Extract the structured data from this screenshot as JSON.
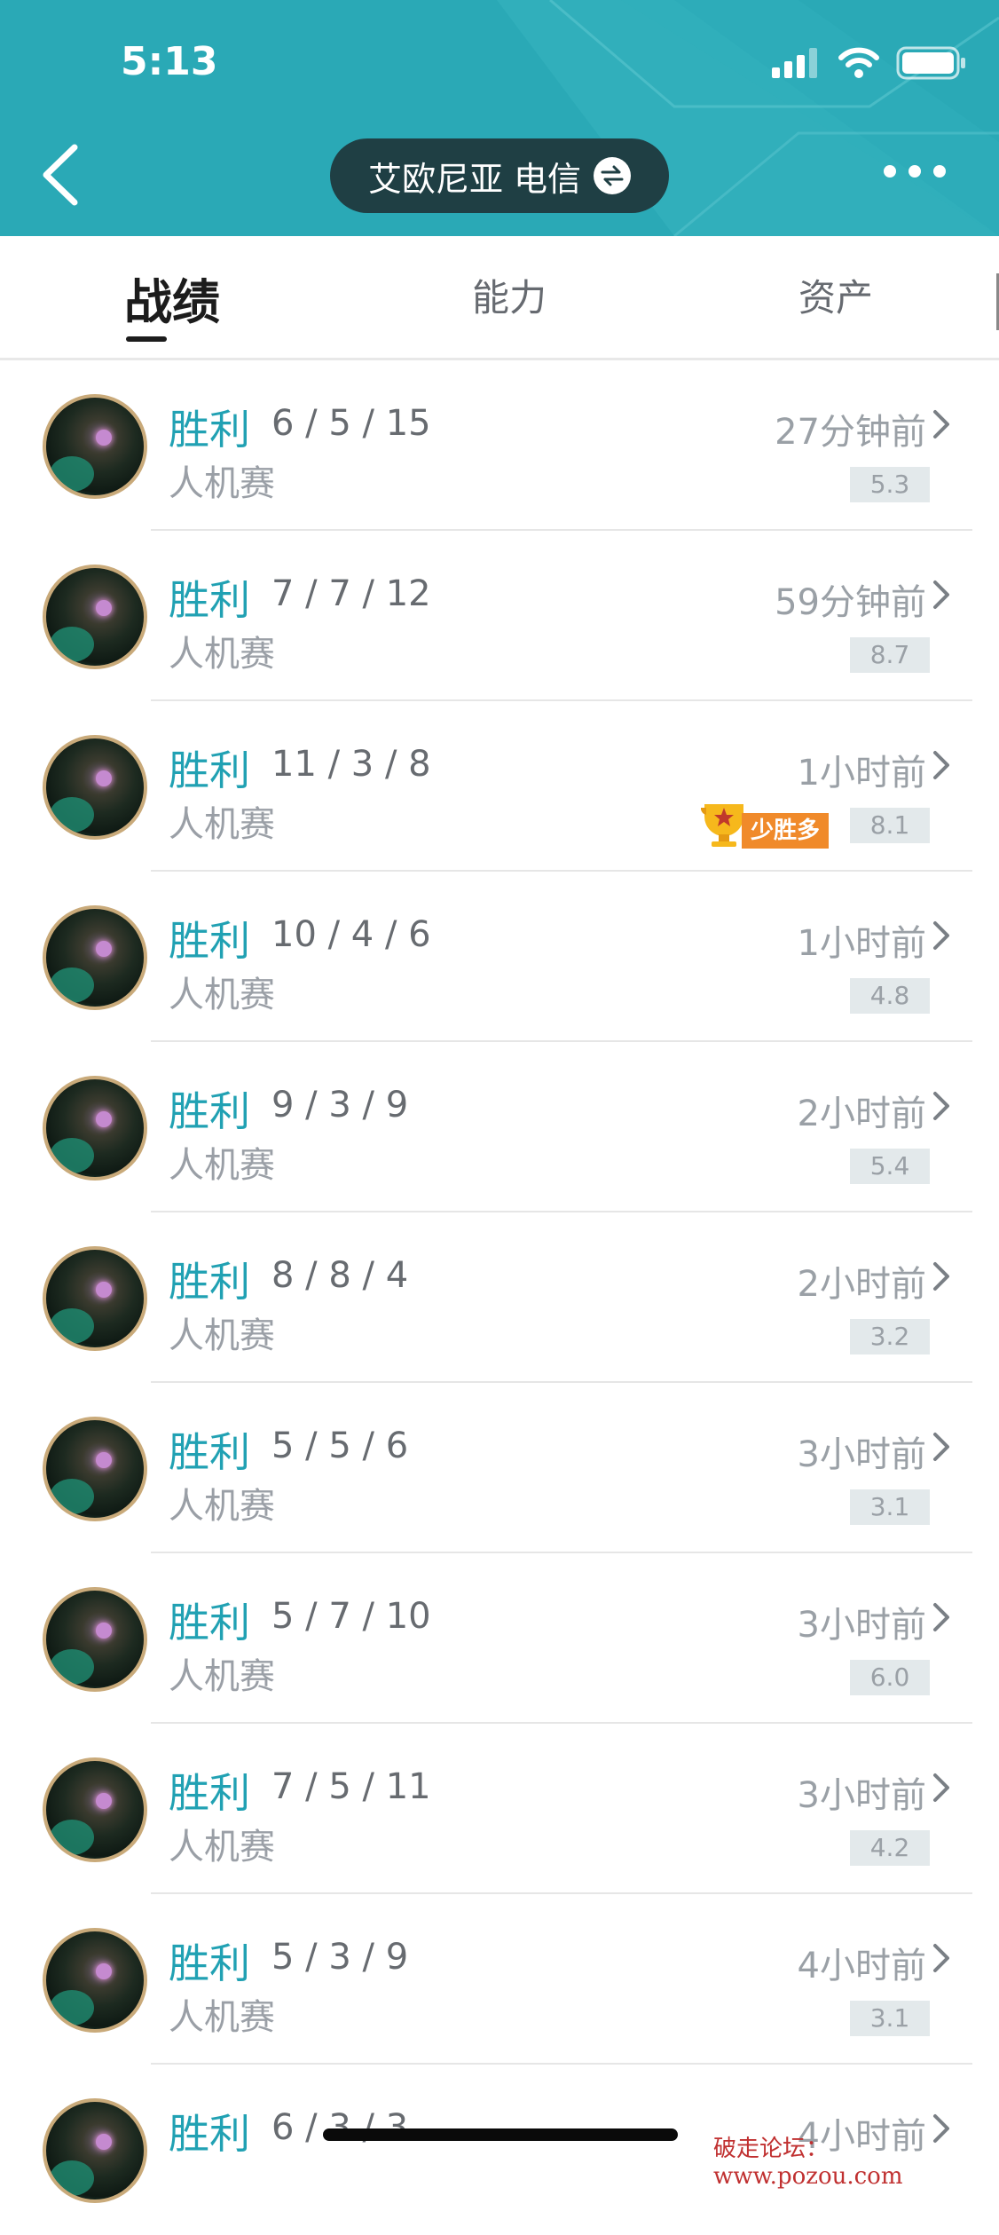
{
  "status_bar": {
    "time": "5:13"
  },
  "header": {
    "server": "艾欧尼亚 电信"
  },
  "tabs": [
    {
      "label": "战绩",
      "active": true
    },
    {
      "label": "能力",
      "active": false
    },
    {
      "label": "资产",
      "active": false
    }
  ],
  "matches": [
    {
      "result": "胜利",
      "kda": "6 / 5 / 15",
      "mode": "人机赛",
      "time": "27分钟前",
      "score": "5.3"
    },
    {
      "result": "胜利",
      "kda": "7 / 7 / 12",
      "mode": "人机赛",
      "time": "59分钟前",
      "score": "8.7"
    },
    {
      "result": "胜利",
      "kda": "11 / 3 / 8",
      "mode": "人机赛",
      "time": "1小时前",
      "score": "8.1",
      "badge": "少胜多"
    },
    {
      "result": "胜利",
      "kda": "10 / 4 / 6",
      "mode": "人机赛",
      "time": "1小时前",
      "score": "4.8"
    },
    {
      "result": "胜利",
      "kda": "9 / 3 / 9",
      "mode": "人机赛",
      "time": "2小时前",
      "score": "5.4"
    },
    {
      "result": "胜利",
      "kda": "8 / 8 / 4",
      "mode": "人机赛",
      "time": "2小时前",
      "score": "3.2"
    },
    {
      "result": "胜利",
      "kda": "5 / 5 / 6",
      "mode": "人机赛",
      "time": "3小时前",
      "score": "3.1"
    },
    {
      "result": "胜利",
      "kda": "5 / 7 / 10",
      "mode": "人机赛",
      "time": "3小时前",
      "score": "6.0"
    },
    {
      "result": "胜利",
      "kda": "7 / 5 / 11",
      "mode": "人机赛",
      "time": "3小时前",
      "score": "4.2"
    },
    {
      "result": "胜利",
      "kda": "5 / 3 / 9",
      "mode": "人机赛",
      "time": "4小时前",
      "score": "3.1"
    },
    {
      "result": "胜利",
      "kda": "6 / 3 / 3",
      "mode": "",
      "time": "4小时前",
      "score": ""
    }
  ],
  "watermark": "破走论坛：www.pozou.com",
  "colors": {
    "header_bg": "#2aa9b6",
    "win_text": "#21a1b3",
    "pill_bg": "#1f3f44"
  }
}
